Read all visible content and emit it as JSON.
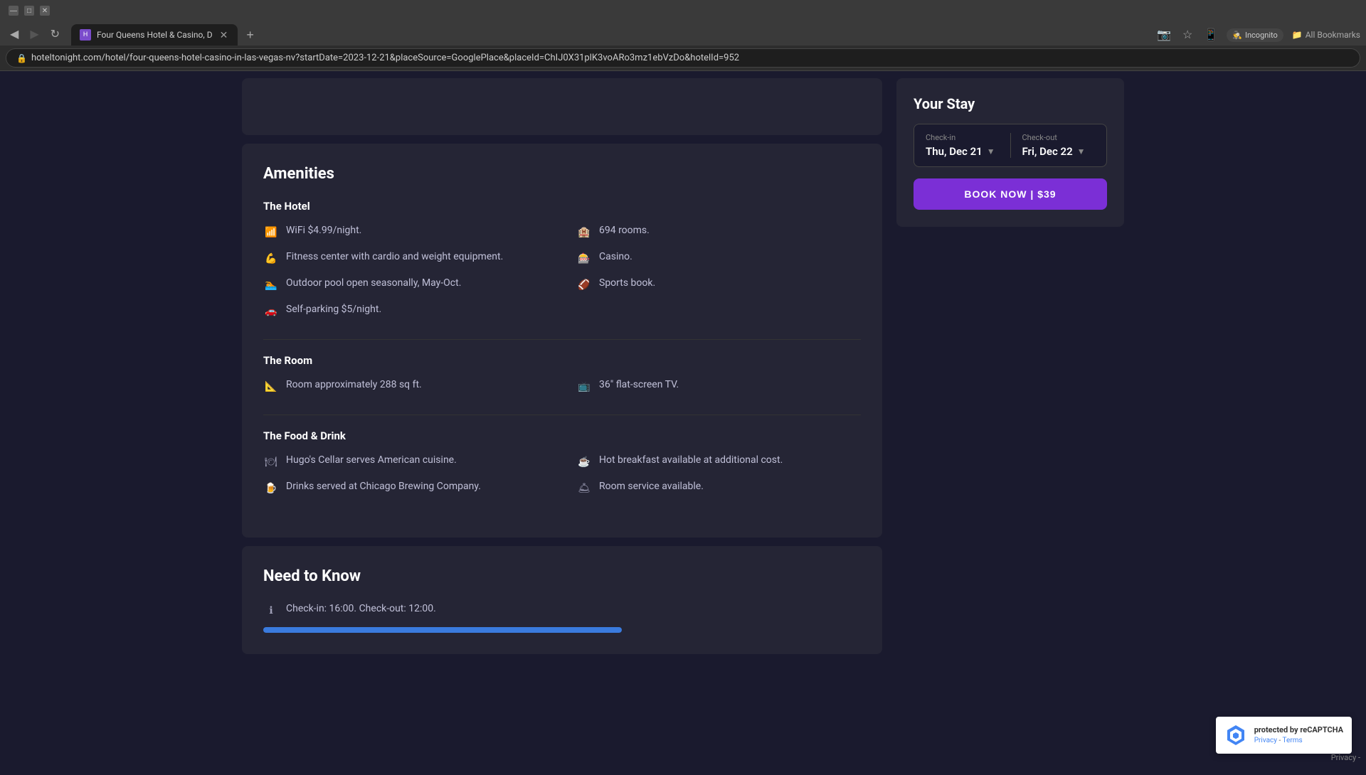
{
  "browser": {
    "tab_title": "Four Queens Hotel & Casino, D",
    "url": "hoteltonight.com/hotel/four-queens-hotel-casino-in-las-vegas-nv?startDate=2023-12-21&placeSource=GooglePlace&placeId=ChIJ0X31plK3voARo3mz1ebVzDo&hotelId=952",
    "incognito_label": "Incognito",
    "bookmarks_label": "All Bookmarks"
  },
  "page": {
    "amenities_section": {
      "title": "Amenities",
      "hotel_section": {
        "subtitle": "The Hotel",
        "items_left": [
          {
            "icon": "wifi-icon",
            "text": "WiFi $4.99/night."
          },
          {
            "icon": "fitness-icon",
            "text": "Fitness center with cardio and weight equipment."
          },
          {
            "icon": "pool-icon",
            "text": "Outdoor pool open seasonally, May-Oct."
          },
          {
            "icon": "parking-icon",
            "text": "Self-parking $5/night."
          }
        ],
        "items_right": [
          {
            "icon": "rooms-icon",
            "text": "694 rooms."
          },
          {
            "icon": "casino-icon",
            "text": "Casino."
          },
          {
            "icon": "sports-icon",
            "text": "Sports book."
          }
        ]
      },
      "room_section": {
        "subtitle": "The Room",
        "items_left": [
          {
            "icon": "room-size-icon",
            "text": "Room approximately 288 sq ft."
          }
        ],
        "items_right": [
          {
            "icon": "tv-icon",
            "text": "36\" flat-screen TV."
          }
        ]
      },
      "food_section": {
        "subtitle": "The Food & Drink",
        "items_left": [
          {
            "icon": "restaurant-icon",
            "text": "Hugo's Cellar serves American cuisine."
          },
          {
            "icon": "drink-icon",
            "text": "Drinks served at Chicago Brewing Company."
          }
        ],
        "items_right": [
          {
            "icon": "breakfast-icon",
            "text": "Hot breakfast available at additional cost."
          },
          {
            "icon": "room-service-icon",
            "text": "Room service available."
          }
        ]
      }
    },
    "need_to_know": {
      "title": "Need to Know"
    },
    "your_stay": {
      "title": "Your Stay",
      "checkin_label": "Check-in",
      "checkin_value": "Thu, Dec 21",
      "checkout_label": "Check-out",
      "checkout_value": "Fri, Dec 22",
      "book_button": "BOOK NOW | $39"
    }
  },
  "recaptcha": {
    "text_line1": "protected by reCAPTCHA",
    "text_line2": "Privacy - Terms"
  },
  "privacy_label": "Privacy -"
}
